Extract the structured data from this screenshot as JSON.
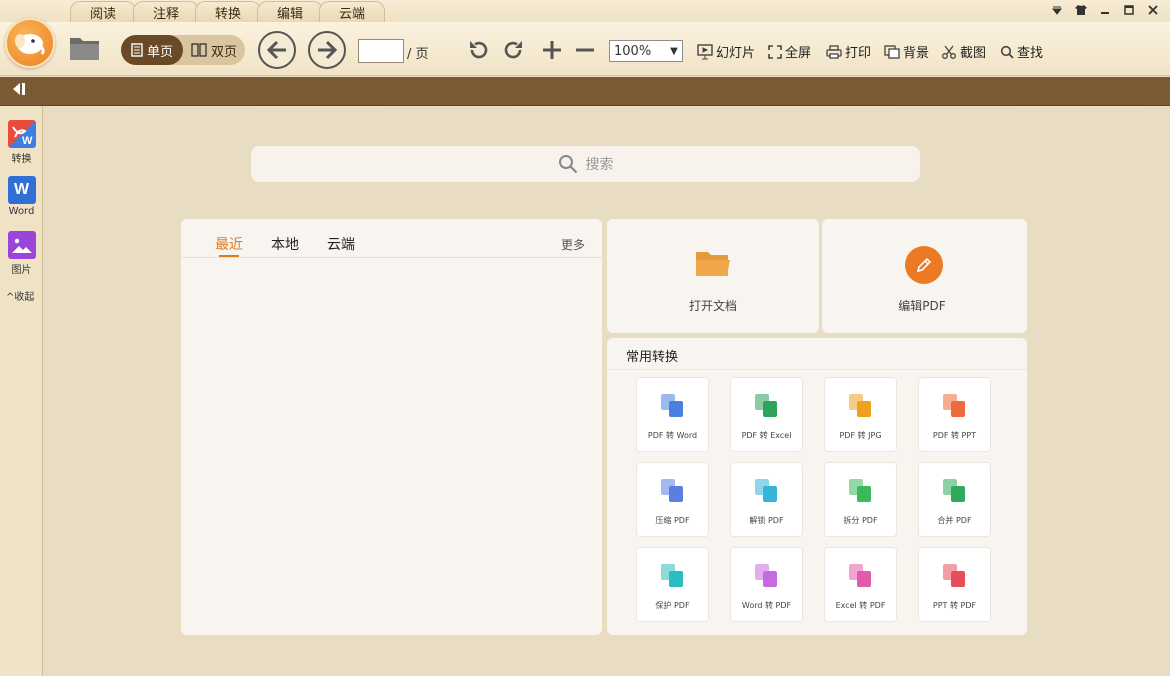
{
  "menu_tabs": [
    "阅读",
    "注释",
    "转换",
    "编辑",
    "云端"
  ],
  "window_controls": [
    "dropdown-icon",
    "skin-icon",
    "minimize-icon",
    "maximize-icon",
    "close-icon"
  ],
  "toolbar": {
    "single_page": "单页",
    "double_page": "双页",
    "page_input_value": "",
    "page_suffix": "/ 页",
    "zoom_value": "100%",
    "slideshow": "幻灯片",
    "fullscreen": "全屏",
    "print": "打印",
    "background": "背景",
    "screenshot": "截图",
    "find": "查找"
  },
  "sidebar": {
    "items": [
      {
        "label": "转换",
        "icon": "pdf-to-word-icon"
      },
      {
        "label": "Word",
        "icon": "word-icon"
      },
      {
        "label": "图片",
        "icon": "image-icon"
      }
    ],
    "collapse": "收起"
  },
  "search": {
    "placeholder": "搜索"
  },
  "recent": {
    "tabs": [
      "最近",
      "本地",
      "云端"
    ],
    "more": "更多"
  },
  "actions": {
    "open_doc": "打开文档",
    "edit_pdf": "编辑PDF"
  },
  "conversions": {
    "title": "常用转换",
    "tiles": [
      {
        "label": "PDF 转 Word",
        "color": "#4a7fe0"
      },
      {
        "label": "PDF 转 Excel",
        "color": "#2ea35a"
      },
      {
        "label": "PDF 转 JPG",
        "color": "#f0a020"
      },
      {
        "label": "PDF 转 PPT",
        "color": "#ee6a3a"
      },
      {
        "label": "压缩 PDF",
        "color": "#5b7fe0"
      },
      {
        "label": "解锁 PDF",
        "color": "#34b5d8"
      },
      {
        "label": "拆分 PDF",
        "color": "#3db85a"
      },
      {
        "label": "合并 PDF",
        "color": "#2faa5a"
      },
      {
        "label": "保护 PDF",
        "color": "#2bbcc0"
      },
      {
        "label": "Word 转 PDF",
        "color": "#c86adf"
      },
      {
        "label": "Excel 转 PDF",
        "color": "#e25ba8"
      },
      {
        "label": "PPT 转 PDF",
        "color": "#e84e5a"
      }
    ]
  },
  "colors": {
    "accent": "#e07a1c",
    "brown": "#6a4a26"
  }
}
